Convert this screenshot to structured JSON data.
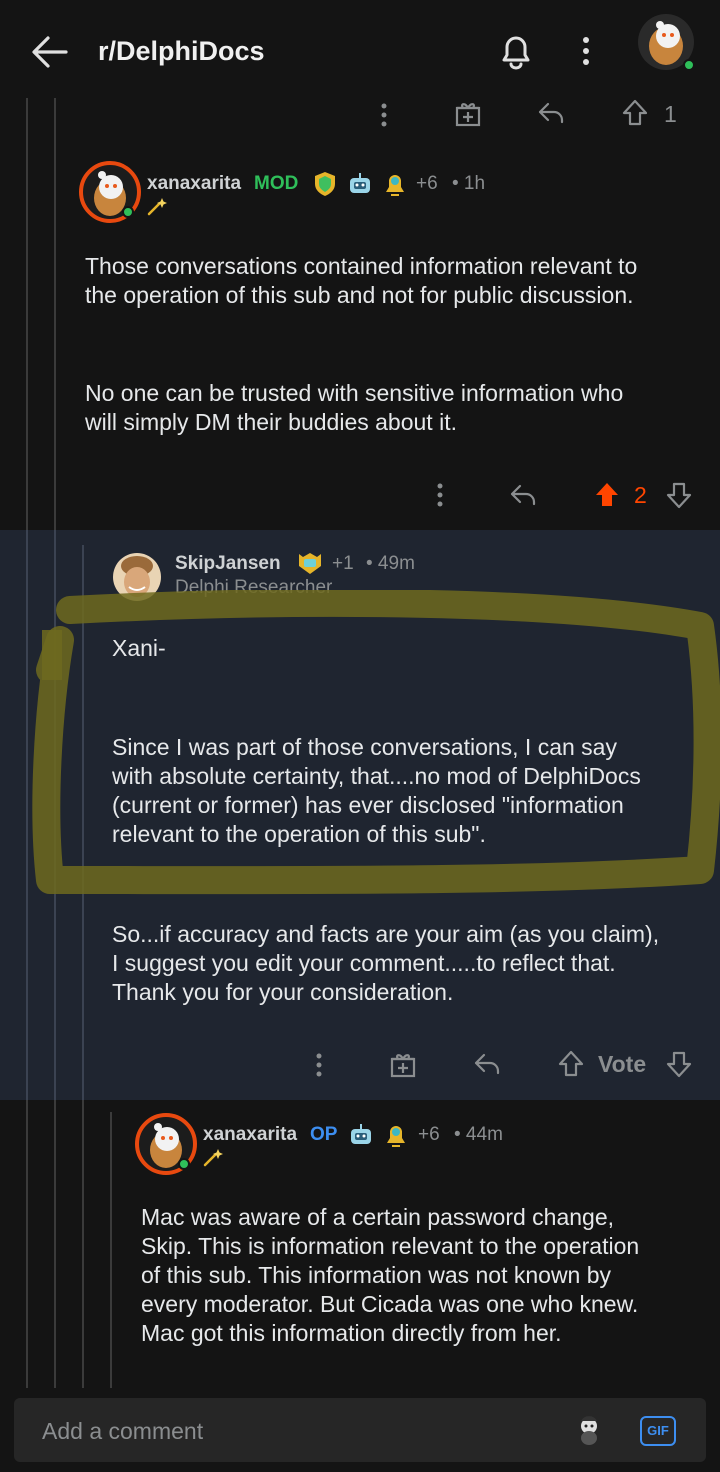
{
  "header": {
    "title": "r/DelphiDocs"
  },
  "top_actions": {
    "vote_count": "1"
  },
  "comments": [
    {
      "username": "xanaxarita",
      "flair": "MOD",
      "award_count": "+6",
      "time": "• 1h",
      "body": [
        "Those conversations contained information relevant to",
        "the operation of this sub and not for public discussion.",
        "No one can be trusted with sensitive information who",
        "will simply DM their buddies about it."
      ],
      "vote_count": "2"
    },
    {
      "username": "SkipJansen",
      "award_count": "+1",
      "time": "• 49m",
      "role": "Delphi Researcher",
      "body": [
        "Xani-",
        "Since I was part of those conversations, I can say",
        "with absolute certainty, that....no mod of DelphiDocs",
        "(current or former) has ever disclosed \"information",
        "relevant to the operation of this sub\".",
        "So...if accuracy and facts are your aim (as you claim),",
        "I suggest you edit your comment.....to reflect that.",
        "Thank you for your consideration."
      ],
      "vote_label": "Vote"
    },
    {
      "username": "xanaxarita",
      "flair": "OP",
      "award_count": "+6",
      "time": "• 44m",
      "body": [
        "Mac was aware of a certain password change,",
        "Skip. This is information relevant to the operation",
        "of this sub. This information was not known by",
        "every moderator. But Cicada was one who knew.",
        "Mac got this information directly from her."
      ]
    }
  ],
  "composer": {
    "placeholder": "Add a comment",
    "gif_label": "GIF"
  },
  "colors": {
    "upvote_active": "#ff4500",
    "mod_flair": "#2fbf5a",
    "op_flair": "#3d8ef0",
    "highlight_panel": "#1f2530",
    "annotation_marker": "#6e6a1e"
  },
  "icons": [
    "back-arrow-icon",
    "bell-icon",
    "more-vertical-icon",
    "gift-icon",
    "reply-icon",
    "upvote-icon",
    "downvote-icon",
    "shield-award-icon",
    "robot-award-icon",
    "bell-award-icon",
    "sparkle-award-icon",
    "gif-icon",
    "snoo-icon"
  ]
}
